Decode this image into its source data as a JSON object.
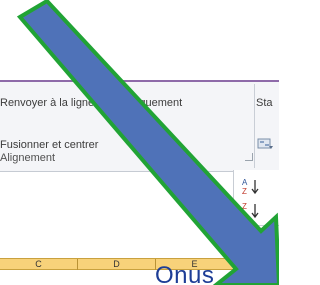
{
  "ribbon": {
    "wrap_text_label": "Renvoyer à la ligne automatiquement",
    "merge_center_label": "Fusionner et centrer",
    "group_label": "Alignement",
    "style_label": "Sta"
  },
  "sort": {
    "az_label": "A Z",
    "za_label": "Z A"
  },
  "columns": [
    "C",
    "D",
    "E"
  ],
  "cell_text": "Onus",
  "colors": {
    "arrow_fill": "#4f72b8",
    "arrow_outline": "#21a335",
    "header_fill": "#f8d27a",
    "cell_text": "#1d3d96"
  }
}
